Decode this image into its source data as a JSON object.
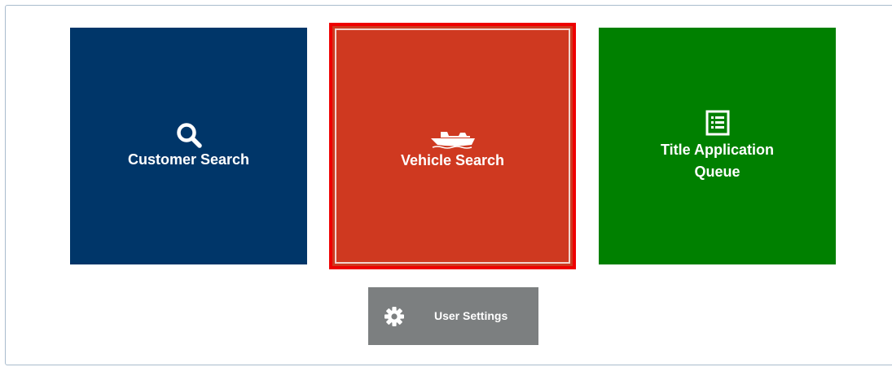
{
  "tiles": {
    "customer_search": {
      "label": "Customer Search",
      "icon": "search-icon",
      "color": "#003669"
    },
    "vehicle_search": {
      "label": "Vehicle Search",
      "icon": "boat-icon",
      "color": "#cf3920",
      "selected": true,
      "highlight_color": "#ee0000"
    },
    "title_application_queue": {
      "label": "Title Application Queue",
      "icon": "list-icon",
      "color": "#008000"
    }
  },
  "user_settings": {
    "label": "User Settings",
    "icon": "gear-icon",
    "color": "#7c7f80"
  }
}
